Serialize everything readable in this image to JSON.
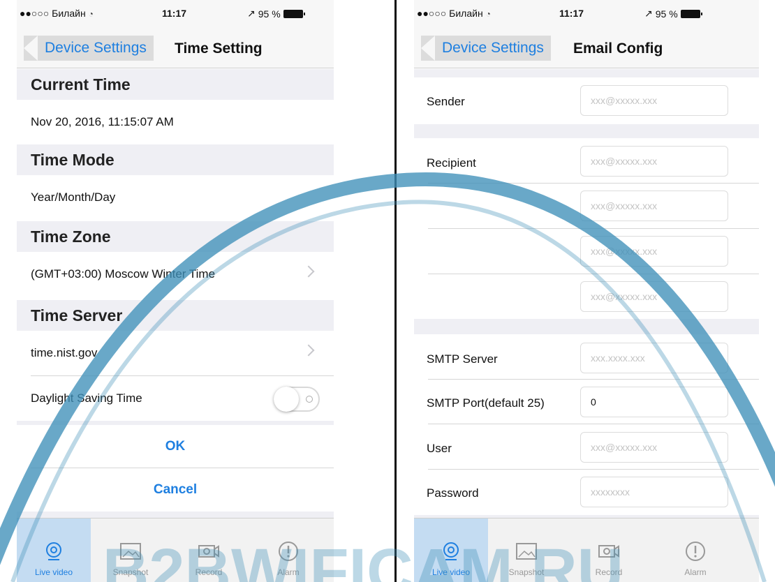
{
  "status_bar": {
    "carrier": "●●○○○ Билайн",
    "time": "11:17",
    "battery": "95 %"
  },
  "left_screen": {
    "nav": {
      "back_label": "Device Settings",
      "title": "Time Setting"
    },
    "sections": {
      "current_time": {
        "header": "Current Time",
        "value": "Nov 20, 2016, 11:15:07 AM"
      },
      "time_mode": {
        "header": "Time Mode",
        "value": "Year/Month/Day"
      },
      "time_zone": {
        "header": "Time Zone",
        "value": "(GMT+03:00) Moscow Winter Time"
      },
      "time_server": {
        "header": "Time Server",
        "value": "time.nist.gov"
      }
    },
    "daylight_saving": {
      "label": "Daylight Saving Time",
      "enabled": false
    },
    "ok_label": "OK",
    "cancel_label": "Cancel"
  },
  "right_screen": {
    "nav": {
      "back_label": "Device Settings",
      "title": "Email Config"
    },
    "sender": {
      "label": "Sender",
      "placeholder": "xxx@xxxxx.xxx"
    },
    "recipient": {
      "label": "Recipient",
      "placeholders": [
        "xxx@xxxxx.xxx",
        "xxx@xxxxx.xxx",
        "xxx@xxxxx.xxx",
        "xxx@xxxxx.xxx"
      ]
    },
    "smtp_server": {
      "label": "SMTP Server",
      "placeholder": "xxx.xxxx.xxx"
    },
    "smtp_port": {
      "label": "SMTP Port(default 25)",
      "value": "0"
    },
    "user": {
      "label": "User",
      "placeholder": "xxx@xxxxx.xxx"
    },
    "password": {
      "label": "Password",
      "placeholder": "xxxxxxxx"
    }
  },
  "tab_bar": {
    "tabs": [
      {
        "label": "Live video",
        "icon": "live-video-icon",
        "active": true
      },
      {
        "label": "Snapshot",
        "icon": "snapshot-icon",
        "active": false
      },
      {
        "label": "Record",
        "icon": "record-icon",
        "active": false
      },
      {
        "label": "Alarm",
        "icon": "alarm-icon",
        "active": false
      }
    ]
  },
  "watermark": {
    "text": "B2BWIFICAM.RU"
  },
  "colors": {
    "accent": "#1e7fe0",
    "section_bg": "#efeff4",
    "active_tab_bg": "#c4dcf2",
    "watermark": "#3f8fb8"
  }
}
